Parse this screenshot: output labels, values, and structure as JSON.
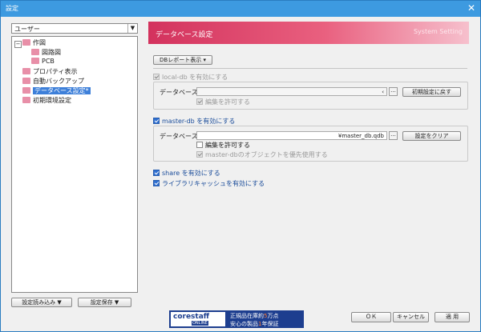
{
  "window": {
    "title": "設定",
    "close_glyph": "✕"
  },
  "left": {
    "dropdown_value": "ユーザー",
    "tree": [
      {
        "label": "作図",
        "level": 0
      },
      {
        "label": "図路図",
        "level": 1
      },
      {
        "label": "PCB",
        "level": 1
      },
      {
        "label": "プロパティ表示",
        "level": 0
      },
      {
        "label": "自動バックアップ",
        "level": 0
      },
      {
        "label": "データベース設定*",
        "level": 0,
        "selected": true
      },
      {
        "label": "初期環境設定",
        "level": 0
      }
    ],
    "load_button": "設定読み込み ▼",
    "save_button": "設定保存 ▼"
  },
  "header": {
    "title": "データベース設定",
    "subtitle": "System Setting"
  },
  "db_report_button": "DBレポート表示 ▾",
  "local_db": {
    "enable_label": "local-db を有効にする",
    "db_label": "データベース",
    "path_value": "‹",
    "reset_button": "初期設定に戻す",
    "allow_edit_label": "編集を許可する"
  },
  "master_db": {
    "enable_label": "master-db を有効にする",
    "db_label": "データベース",
    "path_value": "¥master_db.qdb",
    "clear_button": "設定をクリア",
    "allow_edit_label": "編集を許可する",
    "priority_label": "master-dbのオブジェクトを優先使用する"
  },
  "share_label": "share を有効にする",
  "library_cache_label": "ライブラリキャッシュを有効にする",
  "ellipsis": "...",
  "ad": {
    "logo_text": "corestaff",
    "logo_sub": "ONLINE",
    "line1_a": "正規品在庫約",
    "line1_num": "5",
    "line1_b": "万点",
    "line2_a": "安心の製品",
    "line2_num": "1",
    "line2_b": "年保証"
  },
  "footer": {
    "ok": "ＯＫ",
    "cancel": "キャンセル",
    "apply": "適 用"
  },
  "colors": {
    "accent": "#3d9ae0",
    "header_pink": "#d3325d",
    "selected": "#3d7fd9"
  }
}
